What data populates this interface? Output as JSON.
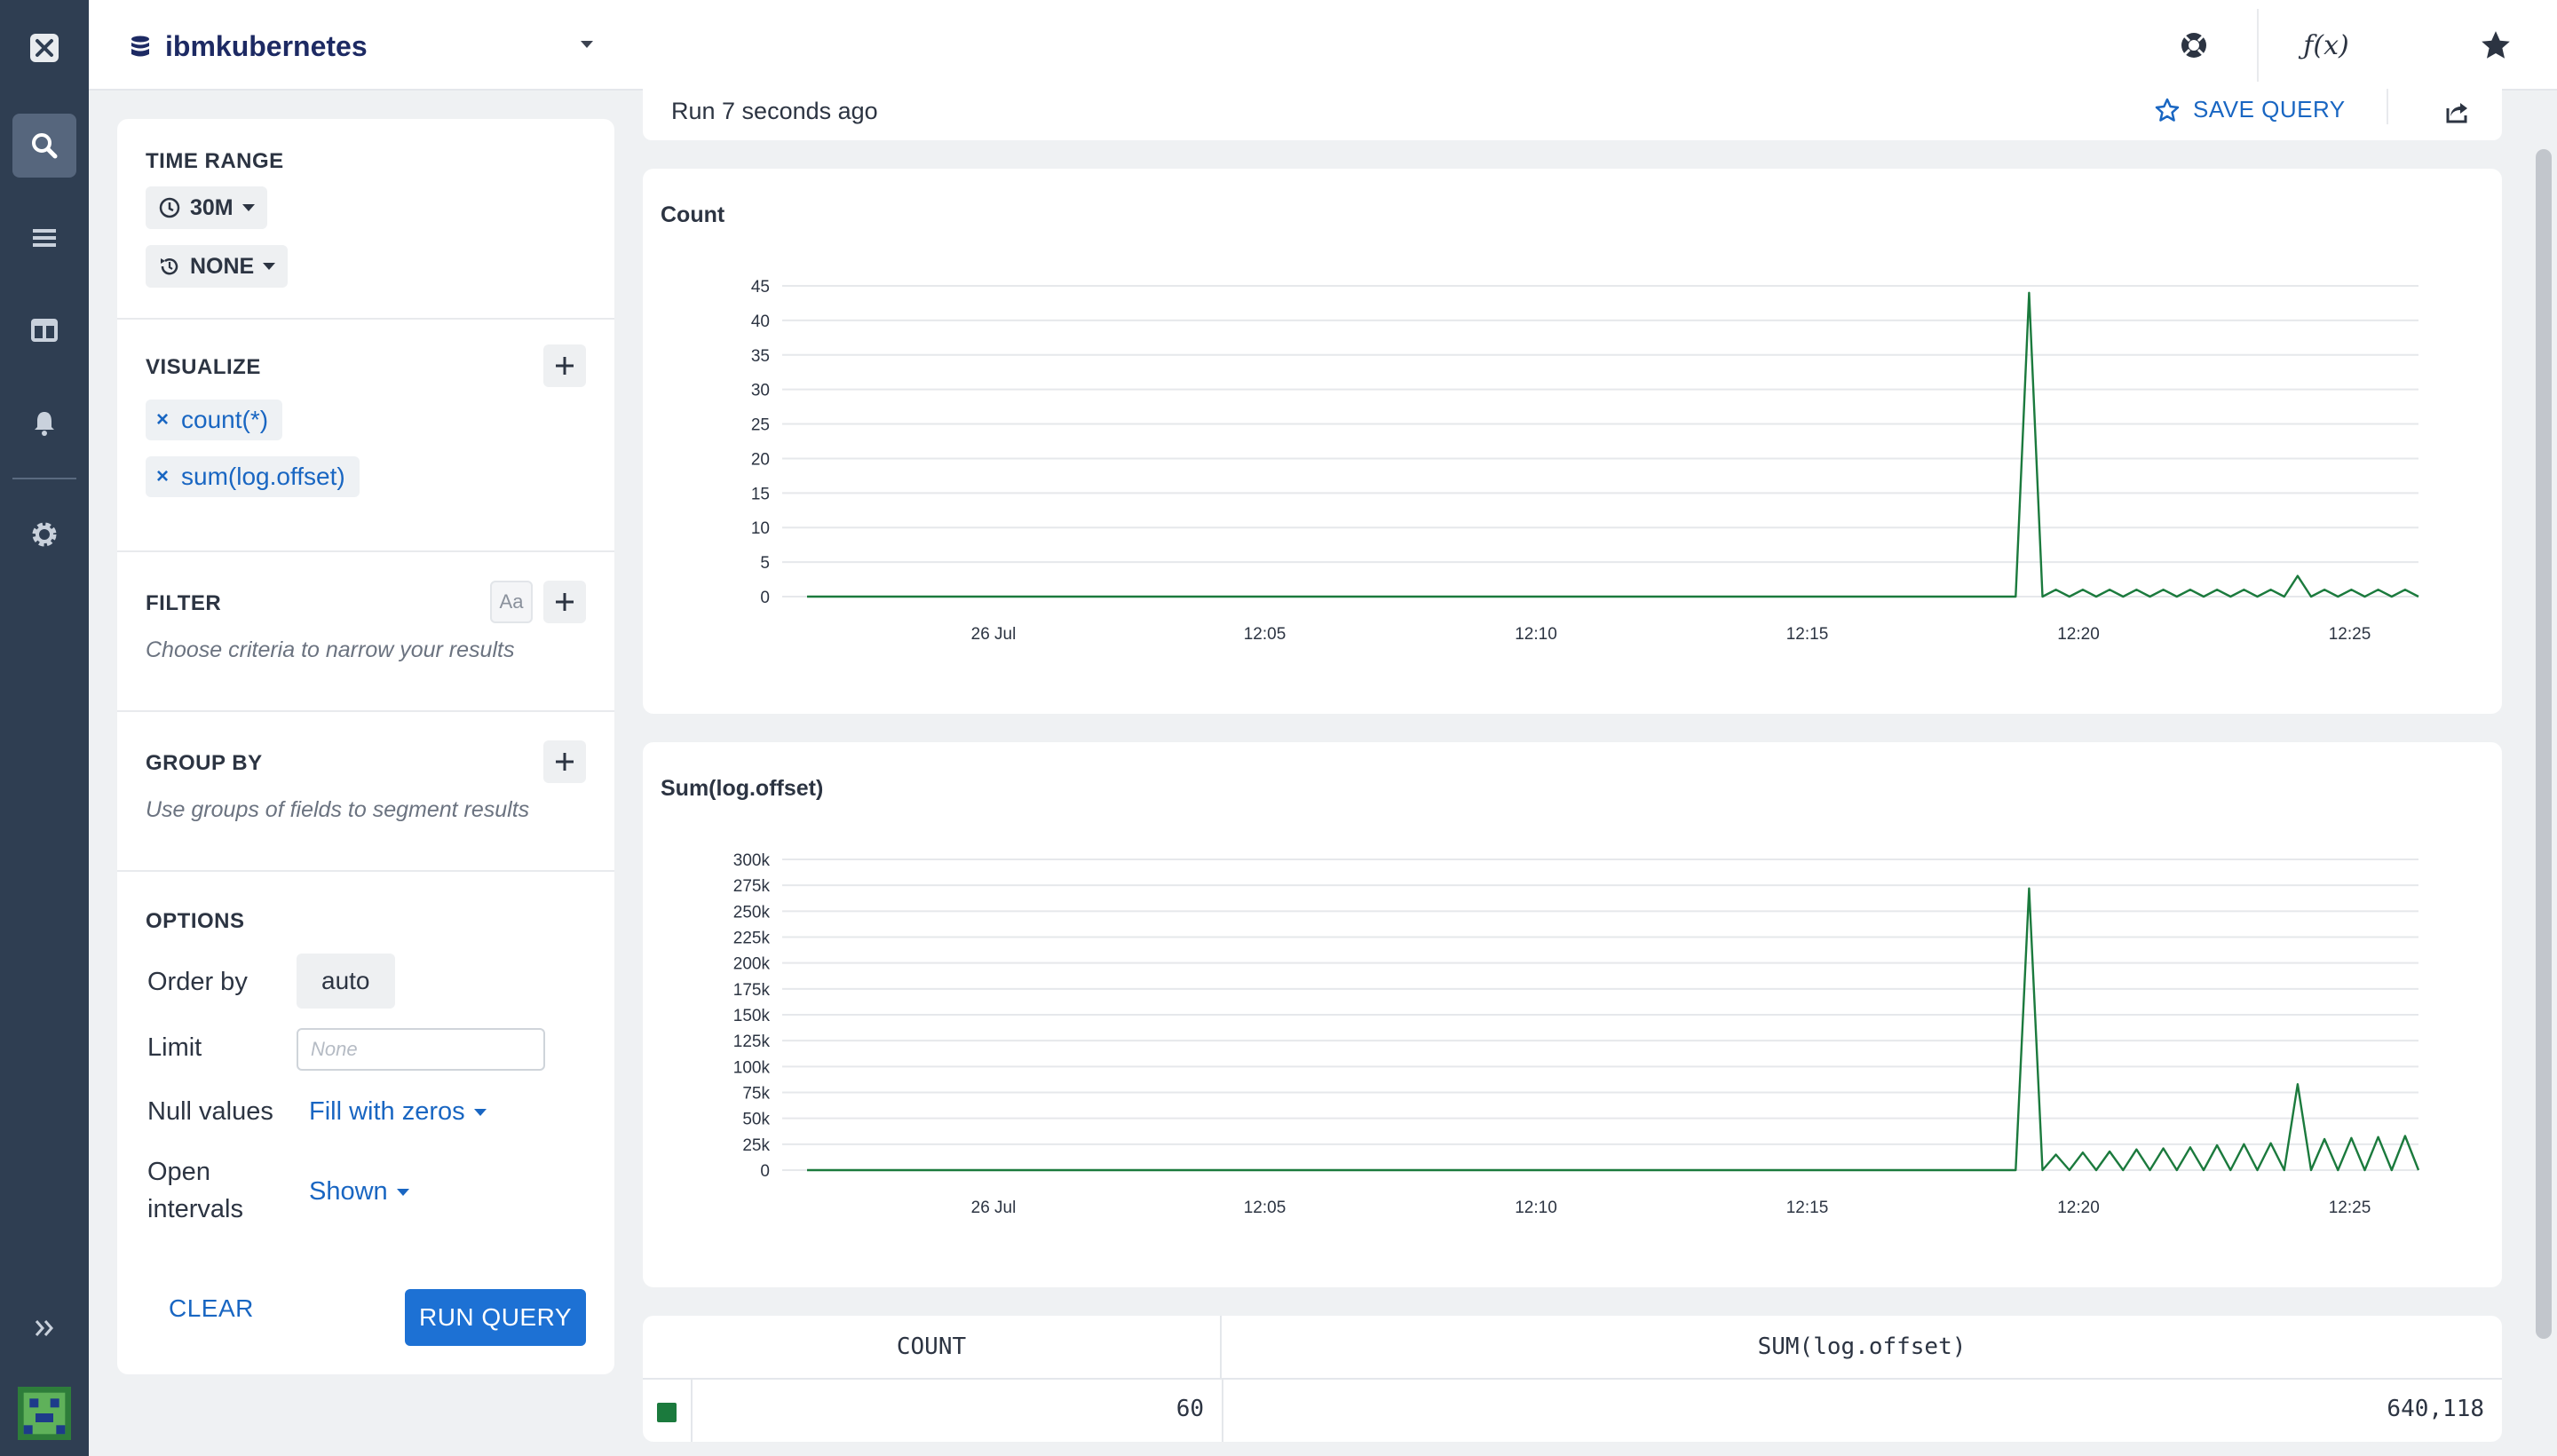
{
  "datasource": {
    "name": "ibmkubernetes"
  },
  "topbar": {
    "icons": [
      "lifebuoy-icon",
      "function-icon",
      "star-icon",
      "history-icon"
    ],
    "function_label": "ƒ(x)"
  },
  "rail": {
    "icons": [
      "close-logo-icon",
      "search-icon",
      "list-icon",
      "dashboard-icon",
      "bell-icon",
      "gear-icon",
      "expand-icon",
      "avatar"
    ]
  },
  "panel": {
    "time_range": {
      "title": "TIME RANGE",
      "range": "30M",
      "compare": "NONE"
    },
    "visualize": {
      "title": "VISUALIZE",
      "items": [
        "count(*)",
        "sum(log.offset)"
      ],
      "remove_glyph": "×"
    },
    "filter": {
      "title": "FILTER",
      "case_toggle": "Aa",
      "hint": "Choose criteria to narrow your results"
    },
    "group_by": {
      "title": "GROUP BY",
      "hint": "Use groups of fields to segment results"
    },
    "options": {
      "title": "OPTIONS",
      "order_by_label": "Order by",
      "order_by_value": "auto",
      "limit_label": "Limit",
      "limit_placeholder": "None",
      "null_label": "Null values",
      "null_value": "Fill with zeros",
      "open_label_1": "Open",
      "open_label_2": "intervals",
      "open_value": "Shown"
    },
    "clear_label": "CLEAR",
    "run_label": "RUN QUERY"
  },
  "results": {
    "run_status": "Run 7 seconds ago",
    "save_label": "SAVE QUERY",
    "table": {
      "headers": [
        "COUNT",
        "SUM(log.offset)"
      ],
      "row": {
        "count": "60",
        "sum": "640,118"
      },
      "swatch_color": "#1b7a3d"
    }
  },
  "chart_data": [
    {
      "type": "line",
      "title": "Count",
      "x_ticks": [
        "26 Jul",
        "12:05",
        "12:10",
        "12:15",
        "12:20",
        "12:25"
      ],
      "y_ticks": [
        "0",
        "5",
        "10",
        "15",
        "20",
        "25",
        "30",
        "35",
        "40",
        "45"
      ],
      "ylim": [
        0,
        45
      ],
      "grid": true,
      "color": "#1b7a3d",
      "series": [
        {
          "values": [
            0,
            0,
            0,
            0,
            0,
            0,
            0,
            0,
            0,
            0,
            0,
            0,
            0,
            0,
            0,
            0,
            0,
            0,
            0,
            0,
            0,
            0,
            0,
            0,
            0,
            0,
            0,
            0,
            0,
            0,
            0,
            0,
            0,
            0,
            0,
            0,
            0,
            0,
            0,
            0,
            0,
            0,
            0,
            0,
            0,
            0,
            0,
            0,
            0,
            0,
            0,
            0,
            0,
            0,
            0,
            0,
            0,
            0,
            0,
            0,
            0,
            0,
            0,
            0,
            0,
            0,
            0,
            0,
            0,
            0,
            0,
            0,
            0,
            0,
            0,
            0,
            0,
            0,
            0,
            0,
            0,
            0,
            0,
            0,
            0,
            0,
            0,
            0,
            0,
            0,
            0,
            44,
            0,
            1,
            0,
            1,
            0,
            1,
            0,
            1,
            0,
            1,
            0,
            1,
            0,
            1,
            0,
            1,
            0,
            1,
            0,
            3,
            0,
            1,
            0,
            1,
            0,
            1,
            0,
            1,
            0
          ]
        }
      ]
    },
    {
      "type": "line",
      "title": "Sum(log.offset)",
      "x_ticks": [
        "26 Jul",
        "12:05",
        "12:10",
        "12:15",
        "12:20",
        "12:25"
      ],
      "y_ticks": [
        "0",
        "25k",
        "50k",
        "75k",
        "100k",
        "125k",
        "150k",
        "175k",
        "200k",
        "225k",
        "250k",
        "275k",
        "300k"
      ],
      "ylim": [
        0,
        300000
      ],
      "grid": true,
      "color": "#1b7a3d",
      "series": [
        {
          "values": [
            0,
            0,
            0,
            0,
            0,
            0,
            0,
            0,
            0,
            0,
            0,
            0,
            0,
            0,
            0,
            0,
            0,
            0,
            0,
            0,
            0,
            0,
            0,
            0,
            0,
            0,
            0,
            0,
            0,
            0,
            0,
            0,
            0,
            0,
            0,
            0,
            0,
            0,
            0,
            0,
            0,
            0,
            0,
            0,
            0,
            0,
            0,
            0,
            0,
            0,
            0,
            0,
            0,
            0,
            0,
            0,
            0,
            0,
            0,
            0,
            0,
            0,
            0,
            0,
            0,
            0,
            0,
            0,
            0,
            0,
            0,
            0,
            0,
            0,
            0,
            0,
            0,
            0,
            0,
            0,
            0,
            0,
            0,
            0,
            0,
            0,
            0,
            0,
            0,
            0,
            0,
            272000,
            0,
            15000,
            0,
            17000,
            0,
            18000,
            0,
            20000,
            0,
            21000,
            0,
            22000,
            0,
            24000,
            0,
            25000,
            0,
            26000,
            0,
            83000,
            0,
            30000,
            0,
            31000,
            0,
            32000,
            0,
            33000,
            0
          ]
        }
      ]
    }
  ]
}
